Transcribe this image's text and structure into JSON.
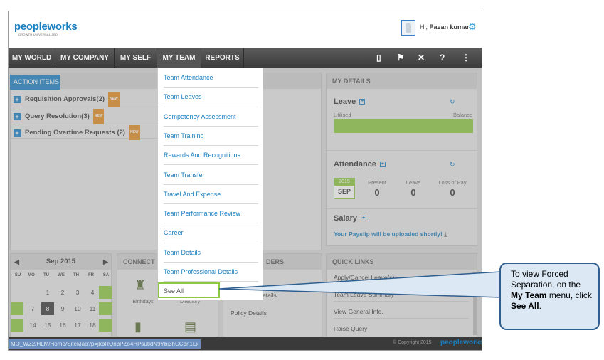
{
  "header": {
    "logo_main": "peopleworks",
    "logo_tagline": "GROWTH UNIVERSALIZED",
    "greeting_prefix": "Hi,",
    "user_name": "Pavan kumar"
  },
  "nav": {
    "items": [
      "MY WORLD",
      "MY COMPANY",
      "MY SELF",
      "MY TEAM",
      "REPORTS"
    ],
    "active": "MY TEAM"
  },
  "action_items": {
    "title": "ACTION ITEMS",
    "rows": [
      {
        "label": "Requisition Approvals(2)",
        "badge": "NEW"
      },
      {
        "label": "Query Resolution(3)",
        "badge": "NEW"
      },
      {
        "label": "Pending Overtime Requests (2)",
        "badge": "NEW"
      }
    ]
  },
  "my_team_menu": {
    "items": [
      "Team Attendance",
      "Team Leaves",
      "Competency Assessment",
      "Team Training",
      "Rewards And Recognitions",
      "Team Transfer",
      "Travel And Expense",
      "Team Performance Review",
      "Career",
      "Team Details",
      "Team Professional Details",
      "See All"
    ]
  },
  "my_details": {
    "title": "MY DETAILS",
    "leave": {
      "title": "Leave",
      "utilised": "Utilised",
      "balance": "Balance"
    },
    "attendance": {
      "title": "Attendance",
      "year": "2015",
      "month": "SEP",
      "present_label": "Present",
      "present_value": "0",
      "leave_label": "Leave",
      "leave_value": "0",
      "lop_label": "Loss of Pay",
      "lop_value": "0"
    },
    "salary": {
      "title": "Salary",
      "note": "Your Payslip will be uploaded shortly!"
    }
  },
  "calendar": {
    "title": "Sep 2015",
    "days_of_week": [
      "SU",
      "MO",
      "TU",
      "WE",
      "TH",
      "FR",
      "SA"
    ],
    "rows": [
      [
        "",
        "",
        "1",
        "2",
        "3",
        "4",
        ""
      ],
      [
        "",
        "7",
        "8",
        "9",
        "10",
        "11",
        ""
      ],
      [
        "",
        "14",
        "15",
        "16",
        "17",
        "18",
        ""
      ]
    ],
    "today": "8"
  },
  "connect": {
    "title": "CONNECT",
    "birthdays": "Birthdays",
    "directory": "Directory"
  },
  "policy": {
    "title_fragment": "DERS",
    "row1_fragment": "etails",
    "row2": "Policy Details"
  },
  "quick_links": {
    "title": "QUICK LINKS",
    "items": [
      "Apply/Cancel Leave(s)",
      "Team Leave Summary",
      "View General Info.",
      "Raise Query"
    ]
  },
  "footer": {
    "url": "MO_WZ2/HLM/Home/SiteMap?p=jkbRQnbPZo4HPsutldN9Ybi3hCCbn1Lx",
    "copyright": "© Copyright 2015",
    "logo": "peopleworks"
  },
  "callout": {
    "text_1": "To view Forced Separation, on the",
    "bold_1": "My Team",
    "text_2": "menu, click",
    "bold_2": "See All",
    "text_3": "."
  },
  "colors": {
    "brand_blue": "#1a7fc0",
    "brand_green": "#8dc63f",
    "nav_dark": "#3c3c3c",
    "callout_border": "#2f5f8f"
  },
  "icons": [
    "user-avatar-icon",
    "gear-icon",
    "book-icon",
    "flag-icon",
    "tools-icon",
    "help-icon",
    "sitemap-icon",
    "refresh-icon",
    "download-icon",
    "cake-icon",
    "directory-icon"
  ]
}
